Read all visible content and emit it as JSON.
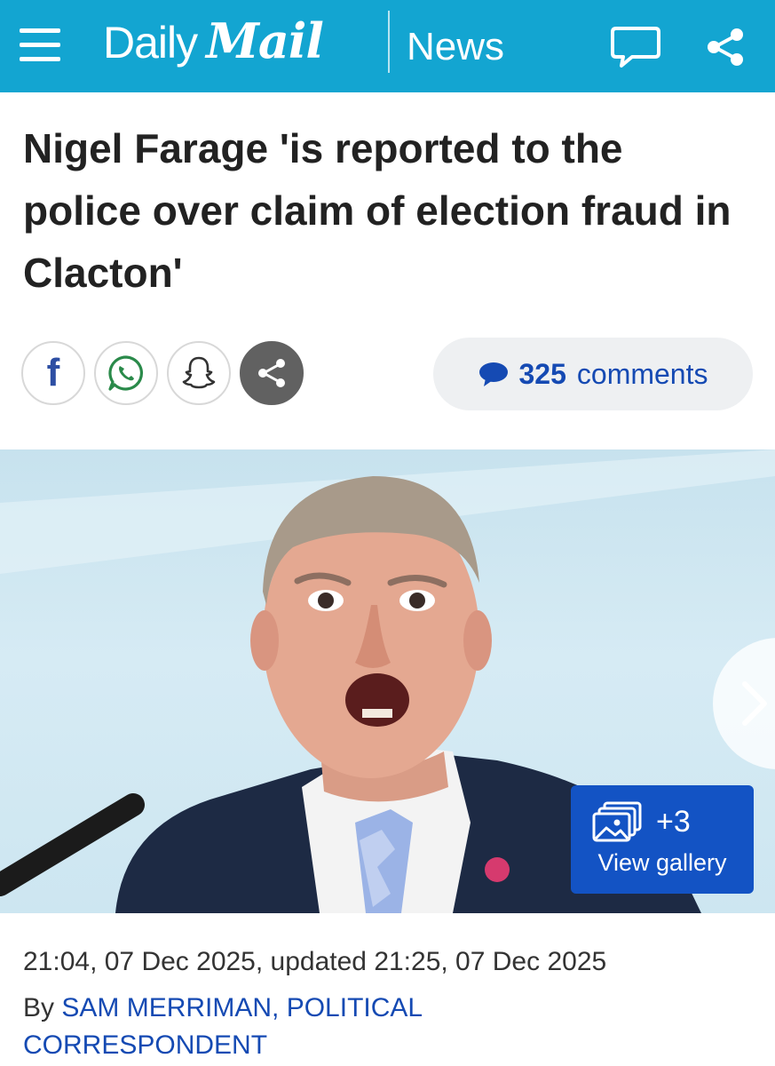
{
  "header": {
    "brand_daily": "Daily",
    "brand_mail": "Mail",
    "section": "News",
    "bg_color": "#13a5d1",
    "icons": [
      "menu-icon",
      "comments-icon",
      "share-icon"
    ]
  },
  "article": {
    "headline": "Nigel Farage 'is reported to the police over claim of election fraud in Clacton'",
    "timestamp": "21:04, 07 Dec 2025, updated 21:25, 07 Dec 2025",
    "byline_prefix": "By",
    "author": "SAM MERRIMAN, POLITICAL CORRESPONDENT"
  },
  "social": {
    "buttons": [
      "facebook-icon",
      "whatsapp-icon",
      "snapchat-icon",
      "share-icon"
    ],
    "facebook_glyph": "f",
    "comments_count": "325",
    "comments_word": "comments"
  },
  "gallery": {
    "count_label": "+3",
    "view_label": "View gallery",
    "button_color": "#1353c4"
  },
  "accent_link_color": "#154ab3"
}
